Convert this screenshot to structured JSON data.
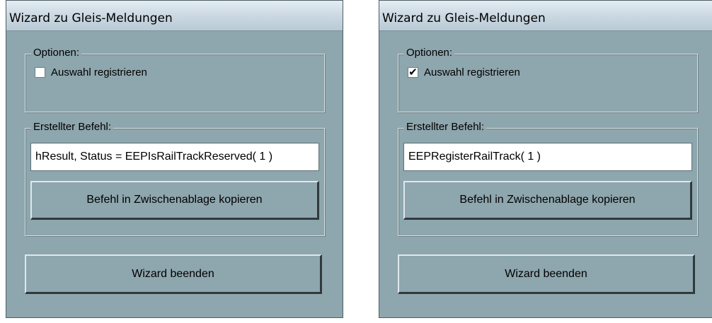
{
  "windows": [
    {
      "title": "Wizard zu Gleis-Meldungen",
      "options_legend": "Optionen:",
      "checkbox_label": "Auswahl registrieren",
      "checkbox_mark": "",
      "command_legend": "Erstellter Befehl:",
      "command_value": "hResult, Status = EEPIsRailTrackReserved( 1 )",
      "copy_button": "Befehl in Zwischenablage kopieren",
      "finish_button": "Wizard beenden"
    },
    {
      "title": "Wizard zu Gleis-Meldungen",
      "options_legend": "Optionen:",
      "checkbox_label": "Auswahl registrieren",
      "checkbox_mark": "✔",
      "command_legend": "Erstellter Befehl:",
      "command_value": "EEPRegisterRailTrack( 1 )",
      "copy_button": "Befehl in Zwischenablage kopieren",
      "finish_button": "Wizard beenden"
    }
  ],
  "colors": {
    "window_bg": "#8ea6ad",
    "title_bar": "#c9d7e1",
    "field_bg": "#ffffff"
  }
}
